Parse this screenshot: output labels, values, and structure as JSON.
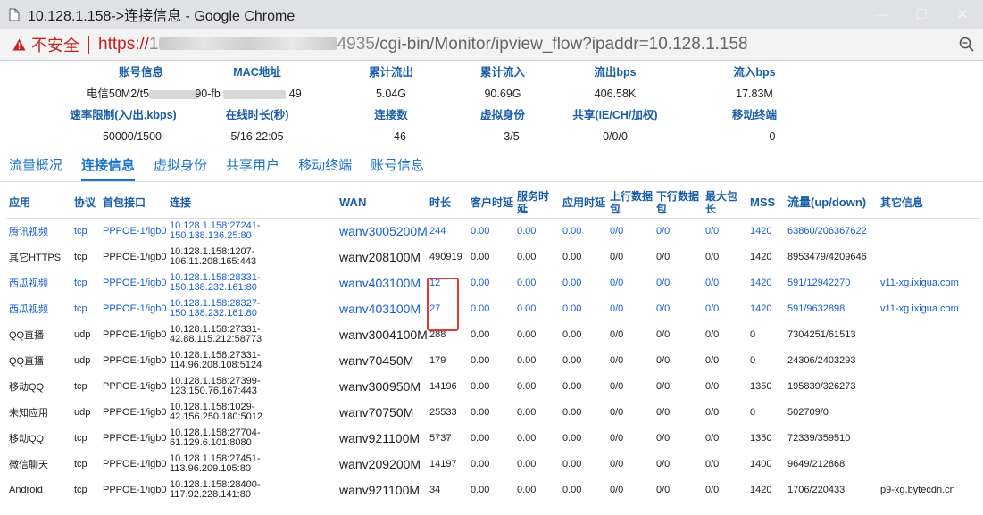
{
  "window": {
    "title": "10.128.1.158->连接信息 - Google Chrome"
  },
  "addressbar": {
    "security_label": "不安全",
    "url_protocol": "https://",
    "url_host_prefix": "1",
    "url_host_suffix": "4935",
    "url_path": "/cgi-bin/Monitor/ipview_flow?ipaddr=10.128.1.158"
  },
  "account_info": {
    "row1_headers": [
      "账号信息",
      "MAC地址",
      "累计流出",
      "累计流入",
      "流出bps",
      "流入bps"
    ],
    "row1_values": [
      "电信50M2/t5",
      "90-fb",
      "5.04G",
      "90.69G",
      "406.58K",
      "17.83M"
    ],
    "row1_value_suffixes": [
      "",
      "49",
      "",
      "",
      "",
      ""
    ],
    "row2_headers": [
      "速率限制(入/出,kbps)",
      "在线时长(秒)",
      "连接数",
      "虚拟身份",
      "共享(IE/CH/加权)",
      "移动终端"
    ],
    "row2_values": [
      "50000/1500",
      "5/16:22:05",
      "46",
      "3/5",
      "0/0/0",
      "0"
    ]
  },
  "tabs": [
    "流量概况",
    "连接信息",
    "虚拟身份",
    "共享用户",
    "移动终端",
    "账号信息"
  ],
  "active_tab_index": 1,
  "table": {
    "headers": [
      "应用",
      "协议",
      "首包接口",
      "连接",
      "WAN",
      "时长",
      "客户时延",
      "服务时延",
      "应用时延",
      "上行数据包",
      "下行数据包",
      "最大包长",
      "MSS",
      "流量(up/down)",
      "其它信息"
    ],
    "rows": [
      {
        "app": "腾讯视频",
        "proto": "tcp",
        "iface": "PPPOE-1/igb0",
        "conn1": "10.128.1.158:27241-",
        "conn2": "150.138.136.25:80",
        "wan": "wanv3005200M",
        "dur": "244",
        "c_lat": "0.00",
        "s_lat": "0.00",
        "a_lat": "0.00",
        "up": "0/0",
        "down": "0/0",
        "maxlen": "0/0",
        "mss": "1420",
        "flow": "63860/206367622",
        "other": "",
        "color": "blue"
      },
      {
        "app": "其它HTTPS",
        "proto": "tcp",
        "iface": "PPPOE-1/igb0",
        "conn1": "10.128.1.158:1207-",
        "conn2": "106.11.208.165:443",
        "wan": "wanv208100M",
        "dur": "490919",
        "c_lat": "0.00",
        "s_lat": "0.00",
        "a_lat": "0.00",
        "up": "0/0",
        "down": "0/0",
        "maxlen": "0/0",
        "mss": "1420",
        "flow": "8953479/4209646",
        "other": "",
        "color": "dark"
      },
      {
        "app": "西瓜视频",
        "proto": "tcp",
        "iface": "PPPOE-1/igb0",
        "conn1": "10.128.1.158:28331-",
        "conn2": "150.138.232.161:80",
        "wan": "wanv403100M",
        "dur": "12",
        "c_lat": "0.00",
        "s_lat": "0.00",
        "a_lat": "0.00",
        "up": "0/0",
        "down": "0/0",
        "maxlen": "0/0",
        "mss": "1420",
        "flow": "591/12942270",
        "other": "v11-xg.ixigua.com",
        "color": "blue"
      },
      {
        "app": "西瓜视频",
        "proto": "tcp",
        "iface": "PPPOE-1/igb0",
        "conn1": "10.128.1.158:28327-",
        "conn2": "150.138.232.161:80",
        "wan": "wanv403100M",
        "dur": "27",
        "c_lat": "0.00",
        "s_lat": "0.00",
        "a_lat": "0.00",
        "up": "0/0",
        "down": "0/0",
        "maxlen": "0/0",
        "mss": "1420",
        "flow": "591/9632898",
        "other": "v11-xg.ixigua.com",
        "color": "blue"
      },
      {
        "app": "QQ直播",
        "proto": "udp",
        "iface": "PPPOE-1/igb0",
        "conn1": "10.128.1.158:27331-",
        "conn2": "42.88.115.212:58773",
        "wan": "wanv3004100M",
        "dur": "288",
        "c_lat": "0.00",
        "s_lat": "0.00",
        "a_lat": "0.00",
        "up": "0/0",
        "down": "0/0",
        "maxlen": "0/0",
        "mss": "0",
        "flow": "7304251/61513",
        "other": "",
        "color": "dark"
      },
      {
        "app": "QQ直播",
        "proto": "udp",
        "iface": "PPPOE-1/igb0",
        "conn1": "10.128.1.158:27331-",
        "conn2": "114.96.208.108:5124",
        "wan": "wanv70450M",
        "dur": "179",
        "c_lat": "0.00",
        "s_lat": "0.00",
        "a_lat": "0.00",
        "up": "0/0",
        "down": "0/0",
        "maxlen": "0/0",
        "mss": "0",
        "flow": "24306/2403293",
        "other": "",
        "color": "dark"
      },
      {
        "app": "移动QQ",
        "proto": "tcp",
        "iface": "PPPOE-1/igb0",
        "conn1": "10.128.1.158:27399-",
        "conn2": "123.150.76.167:443",
        "wan": "wanv300950M",
        "dur": "14196",
        "c_lat": "0.00",
        "s_lat": "0.00",
        "a_lat": "0.00",
        "up": "0/0",
        "down": "0/0",
        "maxlen": "0/0",
        "mss": "1350",
        "flow": "195839/326273",
        "other": "",
        "color": "dark"
      },
      {
        "app": "未知应用",
        "proto": "udp",
        "iface": "PPPOE-1/igb0",
        "conn1": "10.128.1.158:1029-",
        "conn2": "42.156.250.180:5012",
        "wan": "wanv70750M",
        "dur": "25533",
        "c_lat": "0.00",
        "s_lat": "0.00",
        "a_lat": "0.00",
        "up": "0/0",
        "down": "0/0",
        "maxlen": "0/0",
        "mss": "0",
        "flow": "502709/0",
        "other": "",
        "color": "dark"
      },
      {
        "app": "移动QQ",
        "proto": "tcp",
        "iface": "PPPOE-1/igb0",
        "conn1": "10.128.1.158:27704-",
        "conn2": "61.129.6.101:8080",
        "wan": "wanv921100M",
        "dur": "5737",
        "c_lat": "0.00",
        "s_lat": "0.00",
        "a_lat": "0.00",
        "up": "0/0",
        "down": "0/0",
        "maxlen": "0/0",
        "mss": "1350",
        "flow": "72339/359510",
        "other": "",
        "color": "dark"
      },
      {
        "app": "微信聊天",
        "proto": "tcp",
        "iface": "PPPOE-1/igb0",
        "conn1": "10.128.1.158:27451-",
        "conn2": "113.96.209.105:80",
        "wan": "wanv209200M",
        "dur": "14197",
        "c_lat": "0.00",
        "s_lat": "0.00",
        "a_lat": "0.00",
        "up": "0/0",
        "down": "0/0",
        "maxlen": "0/0",
        "mss": "1400",
        "flow": "9649/212868",
        "other": "",
        "color": "dark"
      },
      {
        "app": "Android",
        "proto": "tcp",
        "iface": "PPPOE-1/igb0",
        "conn1": "10.128.1.158:28400-",
        "conn2": "117.92.228.141:80",
        "wan": "wanv921100M",
        "dur": "34",
        "c_lat": "0.00",
        "s_lat": "0.00",
        "a_lat": "0.00",
        "up": "0/0",
        "down": "0/0",
        "maxlen": "0/0",
        "mss": "1420",
        "flow": "1706/220433",
        "other": "p9-xg.bytecdn.cn",
        "color": "dark"
      }
    ]
  },
  "colors": {
    "link_blue": "#1a5dd0",
    "header_blue": "#1a5da8",
    "insecure_red": "#c5221f",
    "highlight_red": "#e53935"
  }
}
